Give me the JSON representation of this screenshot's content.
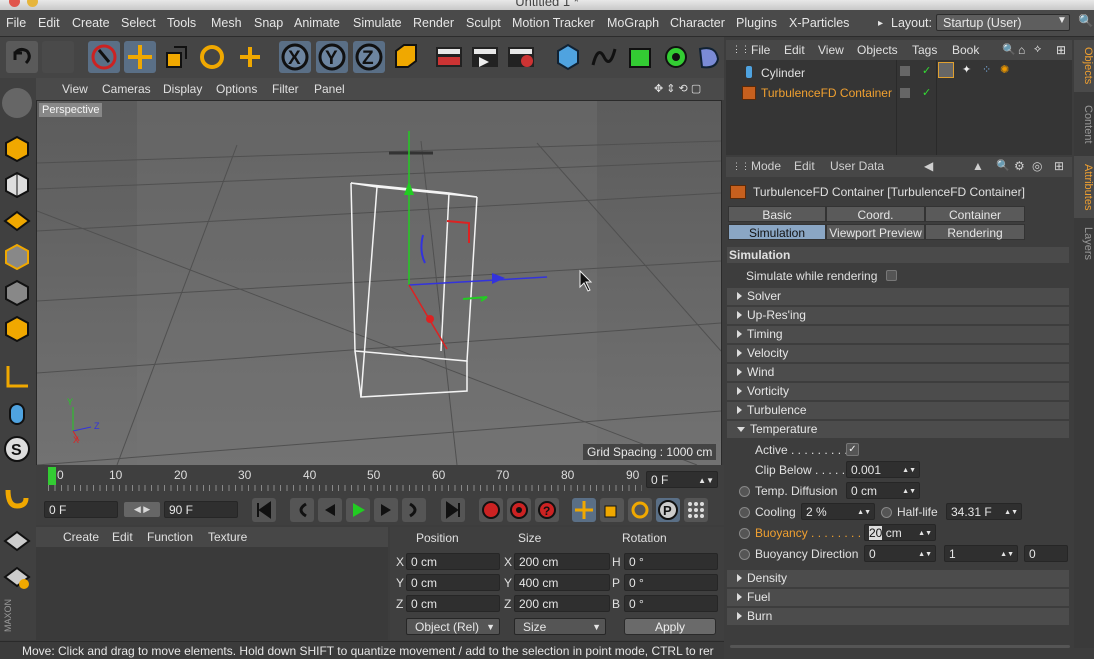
{
  "window": {
    "title": "Untitled 1 *"
  },
  "menu": [
    "File",
    "Edit",
    "Create",
    "Select",
    "Tools",
    "Mesh",
    "Snap",
    "Animate",
    "Simulate",
    "Render",
    "Sculpt",
    "Motion Tracker",
    "MoGraph",
    "Character",
    "Plugins",
    "X-Particles"
  ],
  "layout": {
    "label": "Layout:",
    "value": "Startup (User)"
  },
  "toolbar_icons": [
    "undo-icon",
    "redo-icon",
    "live-selection-icon",
    "move-icon",
    "scale-icon",
    "rotate-icon",
    "move-plus-icon",
    "x-axis-icon",
    "y-axis-icon",
    "z-axis-icon",
    "coordinate-system-icon",
    "render-view-icon",
    "render-picture-viewer-icon",
    "render-settings-icon",
    "cube-icon",
    "spline-icon",
    "nurbs-icon",
    "array-icon",
    "deformer-icon"
  ],
  "viewport": {
    "menu": [
      "View",
      "Cameras",
      "Display",
      "Options",
      "Filter",
      "Panel"
    ],
    "label": "Perspective",
    "grid_spacing": "Grid Spacing : 1000 cm",
    "axis_labels": [
      "Y",
      "Z",
      "X"
    ]
  },
  "timeline": {
    "ticks": [
      "0",
      "10",
      "20",
      "30",
      "40",
      "50",
      "60",
      "70",
      "80",
      "90"
    ],
    "current_frame": "0 F"
  },
  "transport": {
    "start": "0 F",
    "end": "90 F"
  },
  "materials": {
    "menu": [
      "Create",
      "Edit",
      "Function",
      "Texture"
    ]
  },
  "coords": {
    "headers": [
      "Position",
      "Size",
      "Rotation"
    ],
    "rows": [
      {
        "pos_axis": "X",
        "pos": "0 cm",
        "size_axis": "X",
        "size": "200 cm",
        "rot_axis": "H",
        "rot": "0 °"
      },
      {
        "pos_axis": "Y",
        "pos": "0 cm",
        "size_axis": "Y",
        "size": "400 cm",
        "rot_axis": "P",
        "rot": "0 °"
      },
      {
        "pos_axis": "Z",
        "pos": "0 cm",
        "size_axis": "Z",
        "size": "200 cm",
        "rot_axis": "B",
        "rot": "0 °"
      }
    ],
    "mode": "Object (Rel)",
    "size_mode": "Size",
    "apply": "Apply"
  },
  "status": "Move: Click and drag to move elements. Hold down SHIFT to quantize movement / add to the selection in point mode, CTRL to rer",
  "objects": {
    "menu": [
      "File",
      "Edit",
      "View",
      "Objects",
      "Tags",
      "Book"
    ],
    "items": [
      {
        "name": "Cylinder",
        "color": "#d8d8d8"
      },
      {
        "name": "TurbulenceFD Container",
        "color": "#f0a030"
      }
    ]
  },
  "attributes": {
    "menu": [
      "Mode",
      "Edit",
      "User Data"
    ],
    "title": "TurbulenceFD Container [TurbulenceFD Container]",
    "tabs_row1": [
      "Basic",
      "Coord.",
      "Container"
    ],
    "tabs_row2": [
      "Simulation",
      "Viewport Preview",
      "Rendering"
    ],
    "section": "Simulation",
    "simulate_while_rendering": "Simulate while rendering",
    "groups_top": [
      "Solver",
      "Up-Res'ing",
      "Timing",
      "Velocity",
      "Wind",
      "Vorticity",
      "Turbulence"
    ],
    "temperature": "Temperature",
    "active_label": "Active . . . . . . . . .",
    "clip_below_label": "Clip Below . . . . .",
    "clip_below": "0.001",
    "temp_diffusion_label": "Temp. Diffusion",
    "temp_diffusion": "0 cm",
    "cooling_label": "Cooling",
    "cooling": "2 %",
    "half_life_label": "Half-life",
    "half_life": "34.31 F",
    "buoyancy_label": "Buoyancy . . . . . . . . . .",
    "buoyancy_sel": "20",
    "buoyancy_unit": " cm",
    "buoyancy_dir_label": "Buoyancy Direction",
    "buoyancy_dir": [
      "0",
      "1",
      "0"
    ],
    "groups_bottom": [
      "Density",
      "Fuel",
      "Burn"
    ]
  },
  "side_tabs": [
    "Objects",
    "Content",
    "Attributes",
    "Layers"
  ]
}
